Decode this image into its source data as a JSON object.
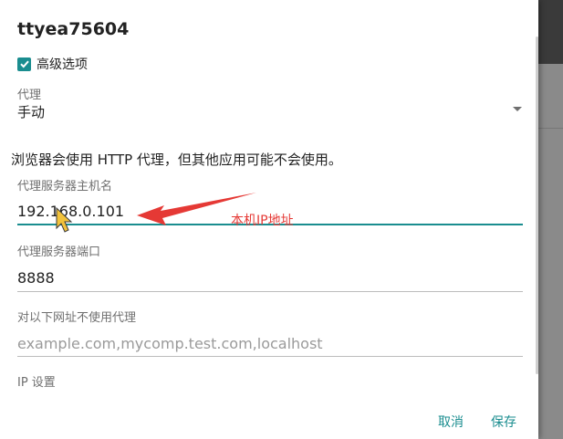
{
  "dialog": {
    "title": "ttyea75604",
    "advanced_label": "高级选项",
    "advanced_checked": true
  },
  "proxy": {
    "label": "代理",
    "value": "手动",
    "note": "浏览器会使用 HTTP 代理，但其他应用可能不会使用。"
  },
  "hostname": {
    "label": "代理服务器主机名",
    "value": "192.168.0.101"
  },
  "port": {
    "label": "代理服务器端口",
    "value": "8888"
  },
  "bypass": {
    "label": "对以下网址不使用代理",
    "placeholder": "example.com,mycomp.test.com,localhost"
  },
  "ip_settings": {
    "label": "IP 设置"
  },
  "buttons": {
    "cancel": "取消",
    "save": "保存"
  },
  "annotation": {
    "text": "本机IP地址"
  },
  "colors": {
    "accent": "#1a8d8f",
    "annotation": "#e53935"
  },
  "icons": {
    "checkbox": "check-icon",
    "dropdown": "chevron-down-icon",
    "cursor": "mouse-cursor-icon",
    "annotation_arrow": "arrow-icon"
  }
}
